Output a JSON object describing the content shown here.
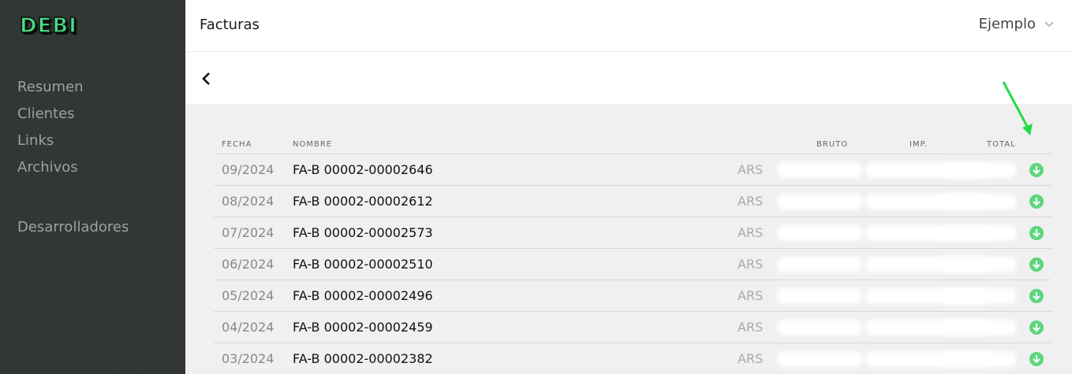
{
  "sidebar": {
    "logo": "DEBI",
    "items": [
      {
        "label": "Resumen"
      },
      {
        "label": "Clientes"
      },
      {
        "label": "Links"
      },
      {
        "label": "Archivos"
      }
    ],
    "developer_label": "Desarrolladores"
  },
  "header": {
    "title": "Facturas",
    "account": "Ejemplo"
  },
  "table": {
    "headers": {
      "fecha": "FECHA",
      "nombre": "NOMBRE",
      "bruto": "BRUTO",
      "imp": "IMP.",
      "total": "TOTAL"
    },
    "rows": [
      {
        "fecha": "09/2024",
        "nombre": "FA-B 00002-00002646",
        "moneda": "ARS"
      },
      {
        "fecha": "08/2024",
        "nombre": "FA-B 00002-00002612",
        "moneda": "ARS"
      },
      {
        "fecha": "07/2024",
        "nombre": "FA-B 00002-00002573",
        "moneda": "ARS"
      },
      {
        "fecha": "06/2024",
        "nombre": "FA-B 00002-00002510",
        "moneda": "ARS"
      },
      {
        "fecha": "05/2024",
        "nombre": "FA-B 00002-00002496",
        "moneda": "ARS"
      },
      {
        "fecha": "04/2024",
        "nombre": "FA-B 00002-00002459",
        "moneda": "ARS"
      },
      {
        "fecha": "03/2024",
        "nombre": "FA-B 00002-00002382",
        "moneda": "ARS"
      }
    ]
  },
  "colors": {
    "brand": "#48e08a",
    "download": "#5ed67e",
    "arrow": "#22dd44",
    "sidebar": "#303532"
  },
  "icons": {
    "back": "chevron-left-icon",
    "dropdown": "chevron-down-icon",
    "download": "download-circle-icon"
  }
}
